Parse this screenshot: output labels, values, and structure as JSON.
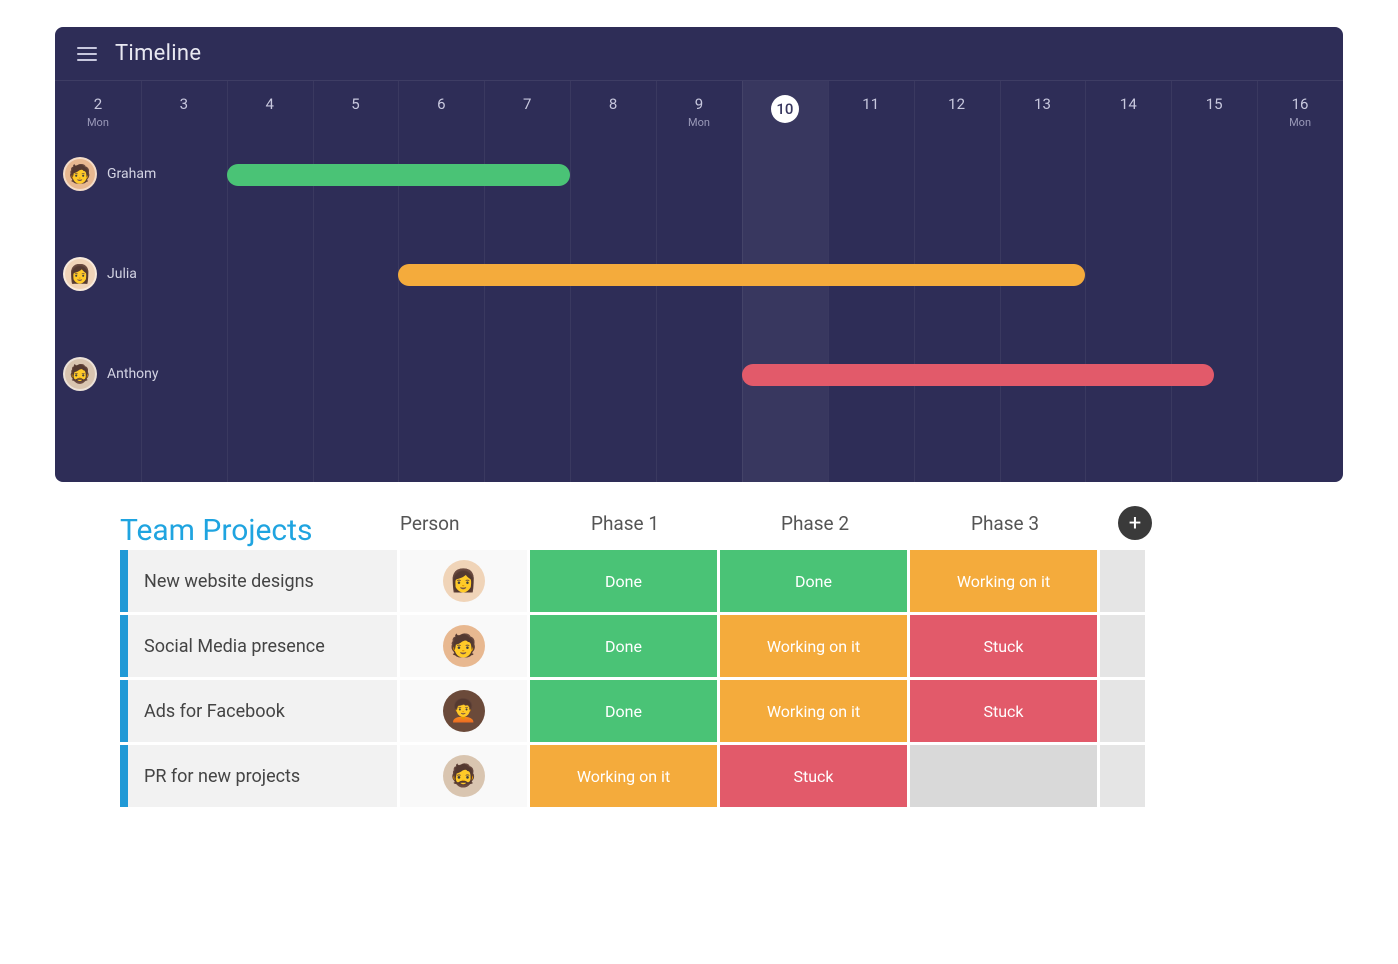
{
  "timeline": {
    "title": "Timeline",
    "today_index": 8,
    "dates": [
      {
        "num": "2",
        "day": "Mon"
      },
      {
        "num": "3",
        "day": ""
      },
      {
        "num": "4",
        "day": ""
      },
      {
        "num": "5",
        "day": ""
      },
      {
        "num": "6",
        "day": ""
      },
      {
        "num": "7",
        "day": ""
      },
      {
        "num": "8",
        "day": ""
      },
      {
        "num": "9",
        "day": "Mon"
      },
      {
        "num": "10",
        "day": ""
      },
      {
        "num": "11",
        "day": ""
      },
      {
        "num": "12",
        "day": ""
      },
      {
        "num": "13",
        "day": ""
      },
      {
        "num": "14",
        "day": ""
      },
      {
        "num": "15",
        "day": ""
      },
      {
        "num": "16",
        "day": "Mon"
      }
    ],
    "people": [
      {
        "name": "Graham",
        "avatar_bg": "#e8b890",
        "avatar_glyph": "🧑",
        "bar_start": 2,
        "bar_end": 5,
        "bar_color": "#4ac376"
      },
      {
        "name": "Julia",
        "avatar_bg": "#f0d4b8",
        "avatar_glyph": "👩",
        "bar_start": 4,
        "bar_end": 11,
        "bar_color": "#f4ab3c"
      },
      {
        "name": "Anthony",
        "avatar_bg": "#d9c5b0",
        "avatar_glyph": "🧔",
        "bar_start": 8,
        "bar_end": 12.5,
        "bar_color": "#e25a6a"
      }
    ]
  },
  "table": {
    "title": "Team Projects",
    "columns": [
      "Person",
      "Phase 1",
      "Phase 2",
      "Phase 3"
    ],
    "status_colors": {
      "Done": "#4ac376",
      "Working on it": "#f4ab3c",
      "Stuck": "#e25a6a",
      "": "#d9d9d9"
    },
    "rows": [
      {
        "name": "New website designs",
        "avatar_bg": "#f0d4b8",
        "avatar_glyph": "👩",
        "phases": [
          "Done",
          "Done",
          "Working on it"
        ]
      },
      {
        "name": "Social Media presence",
        "avatar_bg": "#e8b890",
        "avatar_glyph": "🧑",
        "phases": [
          "Done",
          "Working on it",
          "Stuck"
        ]
      },
      {
        "name": "Ads for Facebook",
        "avatar_bg": "#6b4a3a",
        "avatar_glyph": "🧑‍🦱",
        "phases": [
          "Done",
          "Working on it",
          "Stuck"
        ]
      },
      {
        "name": "PR for new projects",
        "avatar_bg": "#d9c5b0",
        "avatar_glyph": "🧔",
        "phases": [
          "Working on it",
          "Stuck",
          ""
        ]
      }
    ]
  },
  "chart_data": {
    "type": "bar",
    "title": "Timeline",
    "xlabel": "",
    "ylabel": "",
    "x": [
      2,
      3,
      4,
      5,
      6,
      7,
      8,
      9,
      10,
      11,
      12,
      13,
      14,
      15,
      16
    ],
    "today": 10,
    "series": [
      {
        "name": "Graham",
        "start": 4,
        "end": 7,
        "color": "#4ac376"
      },
      {
        "name": "Julia",
        "start": 6,
        "end": 13,
        "color": "#f4ab3c"
      },
      {
        "name": "Anthony",
        "start": 10,
        "end": 14,
        "color": "#e25a6a"
      }
    ]
  }
}
